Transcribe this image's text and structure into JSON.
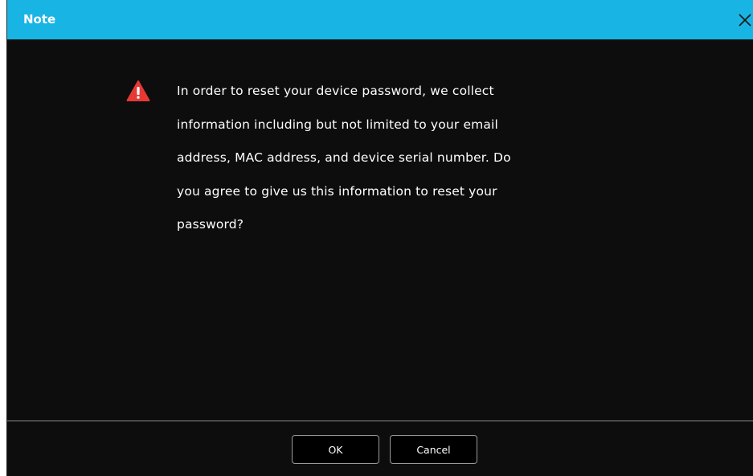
{
  "dialog": {
    "title": "Note",
    "close_icon": "close-icon",
    "warning_icon": "warning-triangle-icon",
    "message_lines": [
      "In order to reset your device password, we collect",
      "information including but not limited to your email",
      "address, MAC address, and device serial number. Do",
      "you agree to give us this information to reset your",
      "password?"
    ],
    "buttons": {
      "ok_label": "OK",
      "cancel_label": "Cancel"
    }
  },
  "colors": {
    "titlebar": "#18b4e4",
    "background": "#0d0d0e",
    "warning": "#e53935",
    "text": "#ffffff"
  }
}
